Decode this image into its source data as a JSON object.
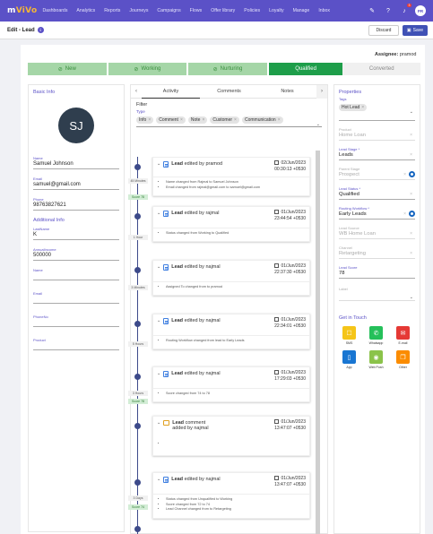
{
  "nav": {
    "logo_m": "m",
    "logo_rest": "ViVo",
    "links": [
      "Dashboards",
      "Analytics",
      "Reports",
      "Journeys",
      "Campaigns",
      "Flows",
      "Offer library",
      "Policies",
      "Loyalty",
      "Manage",
      "Inbox"
    ],
    "notif_count": "3",
    "user_initials": "PR"
  },
  "header": {
    "title": "Edit - Lead",
    "discard": "Discard",
    "save": "Save"
  },
  "assignee": {
    "label": "Assignee:",
    "value": "pramod"
  },
  "stages": [
    {
      "label": "New",
      "state": "done"
    },
    {
      "label": "Working",
      "state": "done"
    },
    {
      "label": "Nurturing",
      "state": "done"
    },
    {
      "label": "Qualified",
      "state": "current"
    },
    {
      "label": "Converted",
      "state": "todo"
    }
  ],
  "basic": {
    "title": "Basic Info",
    "initials": "SJ",
    "fields": [
      {
        "label": "Name",
        "value": "Samuel Johnson"
      },
      {
        "label": "Email",
        "value": "samuel@gmail.com"
      },
      {
        "label": "Phone",
        "value": "98763827621"
      }
    ]
  },
  "additional": {
    "title": "Additional Info",
    "fields": [
      {
        "label": "LastName",
        "value": "K"
      },
      {
        "label": "AnnualIncome",
        "value": "500000"
      },
      {
        "label": "Name",
        "value": ""
      },
      {
        "label": "Email",
        "value": ""
      },
      {
        "label": "PhoneNo",
        "value": ""
      },
      {
        "label": "Product",
        "value": ""
      }
    ]
  },
  "activity": {
    "tabs": [
      "Activity",
      "Comments",
      "Notes"
    ],
    "filter_title": "Filter",
    "filter_type": "Type",
    "chips": [
      "Info",
      "Comment",
      "Note",
      "Customer",
      "Communication"
    ],
    "entries": [
      {
        "title": "Lead",
        "verb": "edited",
        "by": "by pramod",
        "date": "02/Jun/2023",
        "time": "00:30:13 +0530",
        "items": [
          "Name changed from Rajmal to Samuel Johnson",
          "Email changed from rajmal@gmail.com to samuel@gmail.com"
        ]
      },
      {
        "title": "Lead",
        "verb": "edited",
        "by": "by rajmal",
        "date": "01/Jun/2023",
        "time": "23:44:54 +0530",
        "items": [
          "Status changed from Working to Qualified"
        ]
      },
      {
        "title": "Lead",
        "verb": "edited",
        "by": "by najmal",
        "date": "01/Jun/2023",
        "time": "22:37:30 +0530",
        "items": [
          "Assigned To changed from to pramod"
        ]
      },
      {
        "title": "Lead",
        "verb": "edited",
        "by": "by najmal",
        "date": "01/Jun/2023",
        "time": "22:34:01 +0530",
        "items": [
          "Routing Workflow changed from lead to Early Leads"
        ]
      },
      {
        "title": "Lead",
        "verb": "edited",
        "by": "by najmal",
        "date": "01/Jun/2023",
        "time": "17:29:03 +0530",
        "items": [
          "Score changed from 74 to 78"
        ]
      },
      {
        "title": "Lead",
        "verb": "comment",
        "by": "added by najmal",
        "date": "01/Jun/2023",
        "time": "13:47:07 +0530",
        "items": [
          ""
        ]
      },
      {
        "title": "Lead",
        "verb": "edited",
        "by": "by najmal",
        "date": "01/Jun/2023",
        "time": "13:47:07 +0530",
        "items": [
          "Status changed from Unqualified to Working",
          "Score changed from 72 to 74",
          "Lead Channel changed from to Retargeting"
        ]
      }
    ],
    "gaps": [
      {
        "text": "45 Minutes",
        "score": "Score 78"
      },
      {
        "text": "1 Hour",
        "score": ""
      },
      {
        "text": "3 Minutes",
        "score": ""
      },
      {
        "text": "5 Hours",
        "score": ""
      },
      {
        "text": "3 Hours",
        "score": "Score 78"
      },
      {
        "text": "",
        "score": ""
      },
      {
        "text": "3 Days",
        "score": "Score 74"
      }
    ]
  },
  "properties": {
    "title": "Properties",
    "tags_label": "Tags",
    "tag": "Hot Lead",
    "fields": [
      {
        "label": "Product",
        "value": "Home Loan",
        "muted": true,
        "x": true
      },
      {
        "label": "Lead Stage *",
        "value": "Leads",
        "muted": false,
        "x": true
      },
      {
        "label": "Parent Stage",
        "value": "Prospect",
        "muted": true,
        "x": true,
        "eye": true
      },
      {
        "label": "Lead Status *",
        "value": "Qualified",
        "muted": false,
        "x": true
      },
      {
        "label": "Routing Workflow *",
        "value": "Early Leads",
        "muted": false,
        "x": true,
        "eye": true
      },
      {
        "label": "Lead Source",
        "value": "WB Home Loan",
        "muted": true,
        "x": true
      },
      {
        "label": "Channel",
        "value": "Retargeting",
        "muted": true,
        "x": true
      },
      {
        "label": "Lead Score",
        "value": "78",
        "muted": false
      },
      {
        "label": "Label",
        "value": "",
        "muted": true,
        "caret": true
      }
    ],
    "touch_title": "Get in Touch",
    "touch": [
      {
        "label": "SMS",
        "color": "#f5c518",
        "glyph": "☐"
      },
      {
        "label": "Whatsapp",
        "color": "#25c05a",
        "glyph": "✆"
      },
      {
        "label": "E-mail",
        "color": "#e53935",
        "glyph": "✉"
      },
      {
        "label": "App",
        "color": "#1976d2",
        "glyph": "▯"
      },
      {
        "label": "Web Push",
        "color": "#8bc34a",
        "glyph": "◉"
      },
      {
        "label": "Other",
        "color": "#fb8c00",
        "glyph": "❐"
      }
    ]
  }
}
